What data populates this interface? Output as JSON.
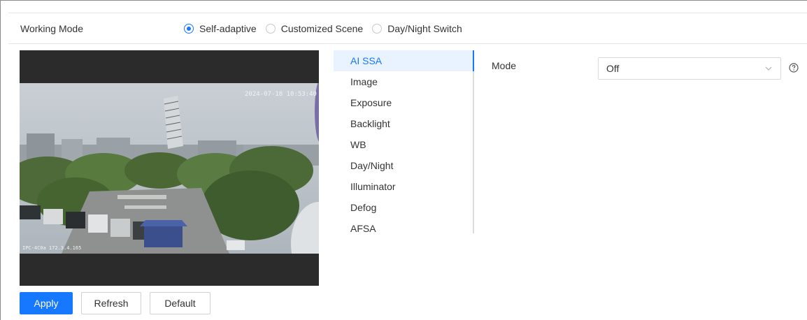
{
  "working_mode": {
    "label": "Working Mode",
    "options": [
      {
        "label": "Self-adaptive",
        "checked": true
      },
      {
        "label": "Customized Scene",
        "checked": false
      },
      {
        "label": "Day/Night Switch",
        "checked": false
      }
    ]
  },
  "preview": {
    "timestamp": "2024-07-18 10:53:40",
    "camera_text": "IPC-4C0a 172.3.4.165"
  },
  "menu": {
    "items": [
      {
        "label": "AI SSA",
        "active": true
      },
      {
        "label": "Image"
      },
      {
        "label": "Exposure"
      },
      {
        "label": "Backlight"
      },
      {
        "label": "WB"
      },
      {
        "label": "Day/Night"
      },
      {
        "label": "Illuminator"
      },
      {
        "label": "Defog"
      },
      {
        "label": "AFSA"
      }
    ]
  },
  "settings": {
    "mode_label": "Mode",
    "mode_value": "Off"
  },
  "actions": {
    "apply": "Apply",
    "refresh": "Refresh",
    "default": "Default"
  },
  "colors": {
    "accent": "#1677ff",
    "menu_active_bg": "#e8f3ff",
    "preview_bg": "#2b2b2b"
  }
}
